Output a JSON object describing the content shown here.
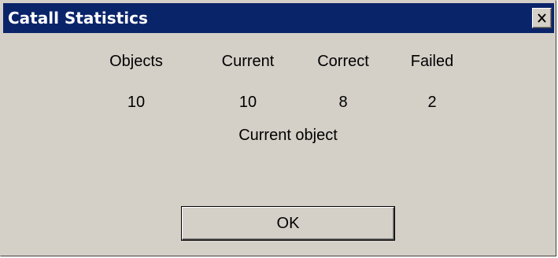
{
  "window": {
    "title": "Catall Statistics",
    "titlebar_color": "#0a246a",
    "background_color": "#d4d0c8"
  },
  "titlebar": {
    "close_icon": "close-icon"
  },
  "stats": {
    "headers": [
      "Objects",
      "Current",
      "Correct",
      "Failed"
    ],
    "values": [
      "10",
      "10",
      "8",
      "2"
    ]
  },
  "current_object_label": "Current object",
  "buttons": {
    "ok_label": "OK"
  }
}
